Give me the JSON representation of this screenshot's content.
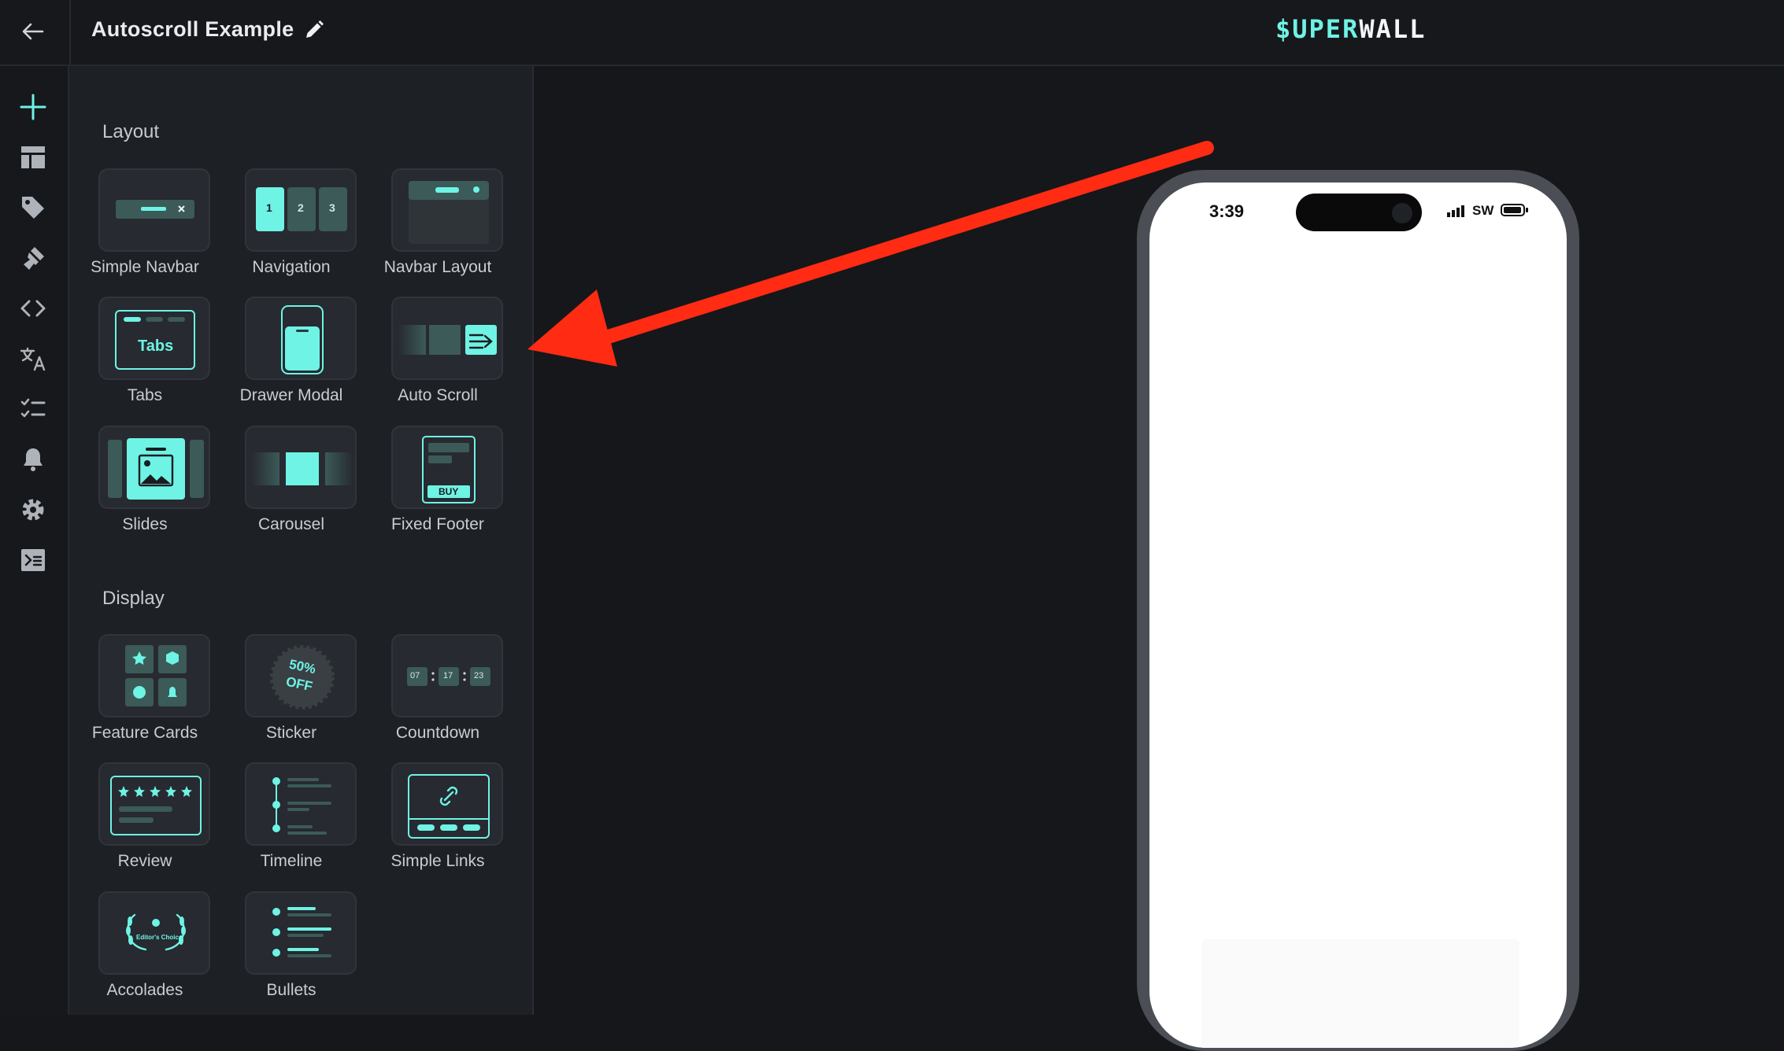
{
  "app": {
    "title": "Autoscroll Example",
    "logo_part1": "$UPER",
    "logo_part2": "WALL"
  },
  "rail": {
    "icons": [
      "add-icon",
      "layout-icon",
      "tag-icon",
      "brush-icon",
      "code-icon",
      "translate-icon",
      "checklist-icon",
      "bell-icon",
      "gear-icon",
      "terminal-icon"
    ],
    "active_color": "#6ef3e5"
  },
  "panel": {
    "sections": [
      {
        "title": "Layout",
        "items": [
          "Simple Navbar",
          "Navigation",
          "Navbar Layout",
          "Tabs",
          "Drawer Modal",
          "Auto Scroll",
          "Slides",
          "Carousel",
          "Fixed Footer"
        ]
      },
      {
        "title": "Display",
        "items": [
          "Feature Cards",
          "Sticker",
          "Countdown",
          "Review",
          "Timeline",
          "Simple Links",
          "Accolades",
          "Bullets"
        ]
      }
    ],
    "tile_text": {
      "navigation_nums": [
        "1",
        "2",
        "3"
      ],
      "tabs_word": "Tabs",
      "footer_buy": "BUY",
      "sticker_line1": "50%",
      "sticker_line2": "OFF",
      "countdown": [
        "07",
        "17",
        "23"
      ],
      "accolade": "Editor's Choice"
    }
  },
  "phone": {
    "time": "3:39",
    "carrier": "SW"
  },
  "colors": {
    "accent": "#6ef3e5",
    "arrow": "#ff2b12",
    "panel": "#1d2025",
    "tile": "#272a30"
  }
}
